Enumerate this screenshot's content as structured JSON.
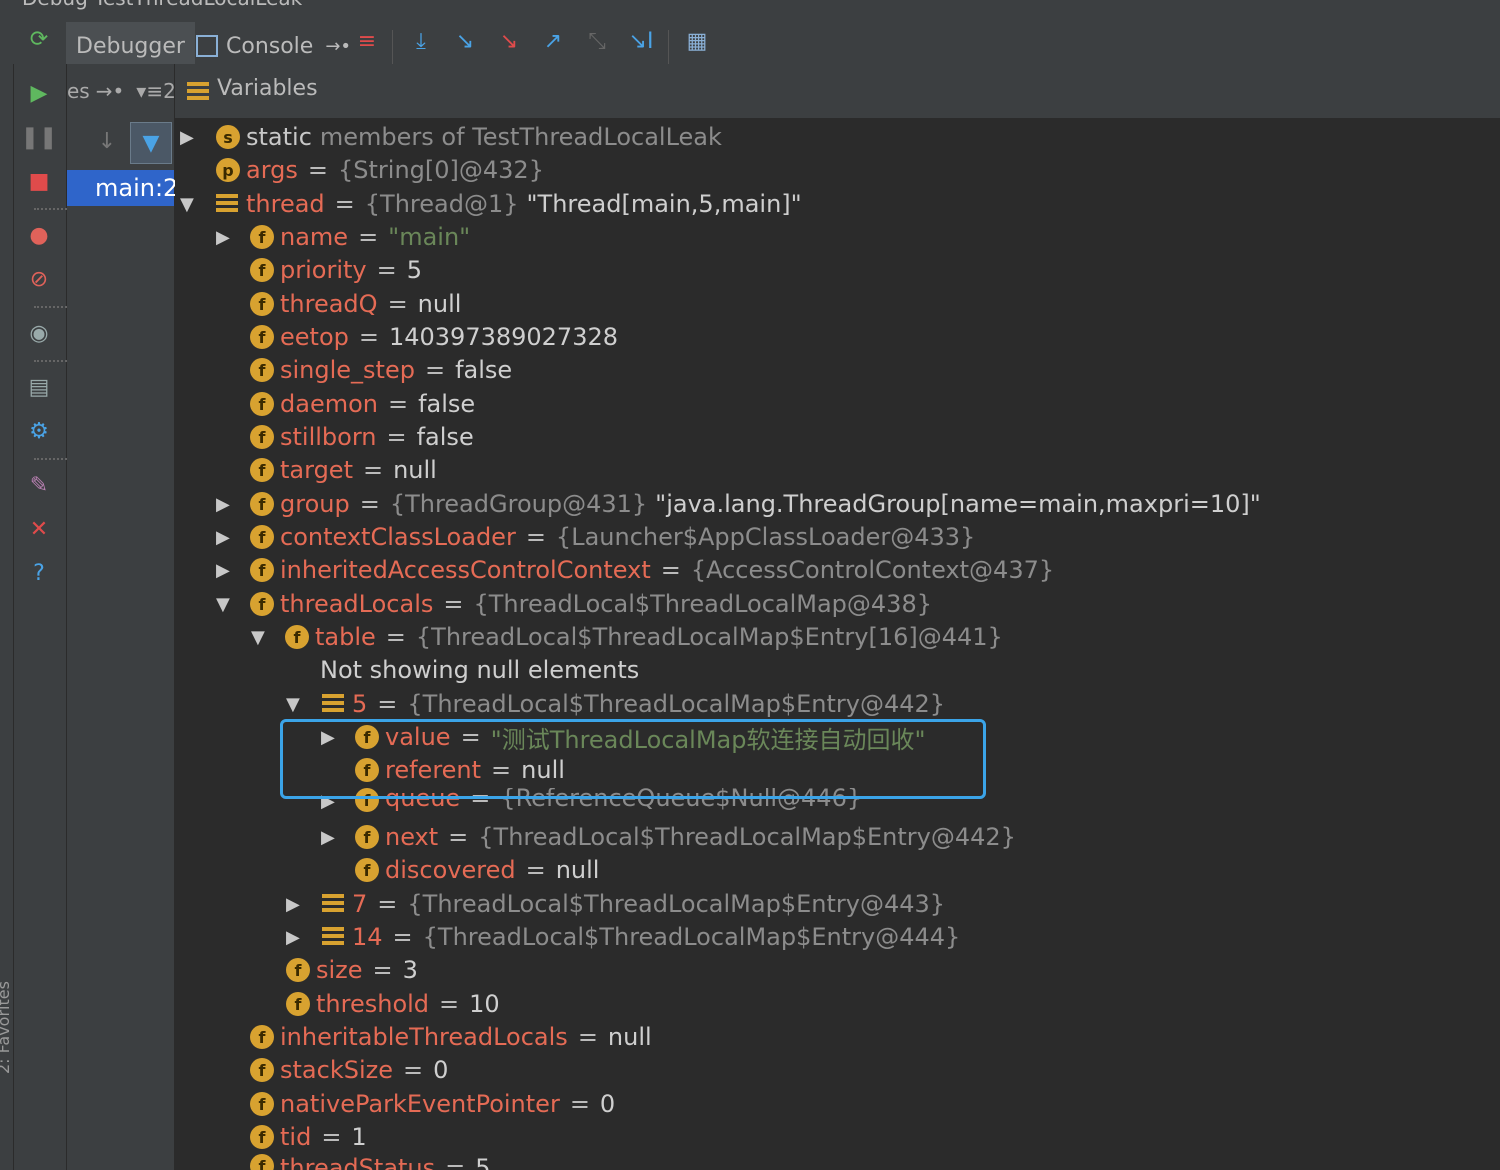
{
  "window_title": "Debug  TestThreadLocalLeak",
  "tabs": {
    "debugger": "Debugger",
    "console": "Console"
  },
  "frames": {
    "truncated_label": "es",
    "thread_label": "main:2"
  },
  "variables_title": "Variables",
  "left_edge_label": "2: Favorites",
  "rows": [
    {
      "name": "static",
      "name2": "members of TestThreadLocalLeak"
    },
    {
      "name": "args",
      "eq": "=",
      "ref": "{String[0]@432}"
    },
    {
      "name": "thread",
      "eq": "=",
      "ref": "{Thread@1}",
      "val": "\"Thread[main,5,main]\""
    },
    {
      "name": "name",
      "eq": "=",
      "str": "\"main\""
    },
    {
      "name": "priority",
      "eq": "=",
      "val": "5"
    },
    {
      "name": "threadQ",
      "eq": "=",
      "val": "null"
    },
    {
      "name": "eetop",
      "eq": "=",
      "val": "140397389027328"
    },
    {
      "name": "single_step",
      "eq": "=",
      "val": "false"
    },
    {
      "name": "daemon",
      "eq": "=",
      "val": "false"
    },
    {
      "name": "stillborn",
      "eq": "=",
      "val": "false"
    },
    {
      "name": "target",
      "eq": "=",
      "val": "null"
    },
    {
      "name": "group",
      "eq": "=",
      "ref": "{ThreadGroup@431}",
      "val": "\"java.lang.ThreadGroup[name=main,maxpri=10]\""
    },
    {
      "name": "contextClassLoader",
      "eq": "=",
      "ref": "{Launcher$AppClassLoader@433}"
    },
    {
      "name": "inheritedAccessControlContext",
      "eq": "=",
      "ref": "{AccessControlContext@437}"
    },
    {
      "name": "threadLocals",
      "eq": "=",
      "ref": "{ThreadLocal$ThreadLocalMap@438}"
    },
    {
      "name": "table",
      "eq": "=",
      "ref": "{ThreadLocal$ThreadLocalMap$Entry[16]@441}"
    },
    {
      "val": "Not showing null elements"
    },
    {
      "name": "5",
      "eq": "=",
      "ref": "{ThreadLocal$ThreadLocalMap$Entry@442}"
    },
    {
      "name": "value",
      "eq": "=",
      "str": "\"测试ThreadLocalMap软连接自动回收\""
    },
    {
      "name": "referent",
      "eq": "=",
      "val": "null"
    },
    {
      "name": "queue",
      "eq": "=",
      "ref": "{ReferenceQueue$Null@446}"
    },
    {
      "name": "next",
      "eq": "=",
      "ref": "{ThreadLocal$ThreadLocalMap$Entry@442}"
    },
    {
      "name": "discovered",
      "eq": "=",
      "val": "null"
    },
    {
      "name": "7",
      "eq": "=",
      "ref": "{ThreadLocal$ThreadLocalMap$Entry@443}"
    },
    {
      "name": "14",
      "eq": "=",
      "ref": "{ThreadLocal$ThreadLocalMap$Entry@444}"
    },
    {
      "name": "size",
      "eq": "=",
      "val": "3"
    },
    {
      "name": "threshold",
      "eq": "=",
      "val": "10"
    },
    {
      "name": "inheritableThreadLocals",
      "eq": "=",
      "val": "null"
    },
    {
      "name": "stackSize",
      "eq": "=",
      "val": "0"
    },
    {
      "name": "nativeParkEventPointer",
      "eq": "=",
      "val": "0"
    },
    {
      "name": "tid",
      "eq": "=",
      "val": "1"
    },
    {
      "name": "threadStatus",
      "eq": "=",
      "val": "5"
    }
  ],
  "badges": {
    "static": "s",
    "param": "p",
    "field": "f"
  },
  "colors": {
    "field_name": "#e56b55",
    "string": "#6a8759",
    "selection": "#2f65ca",
    "highlight_box": "#3ba4e8",
    "badge": "#d8a230"
  }
}
